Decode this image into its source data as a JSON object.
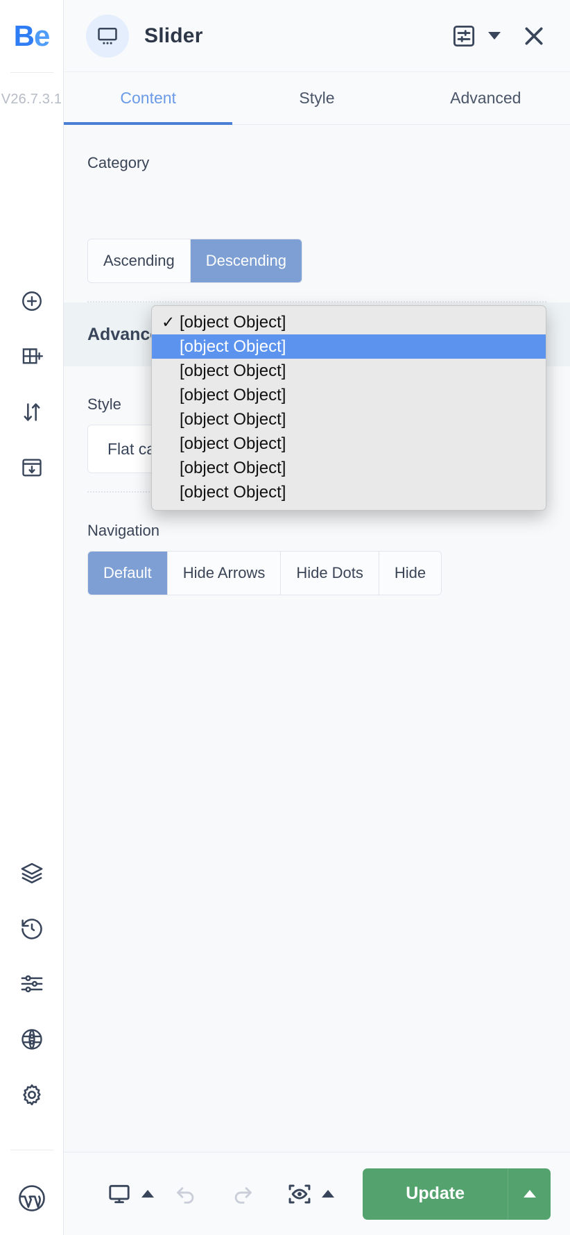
{
  "rail": {
    "logo_first": "Be",
    "logo_b": "B",
    "logo_e": "e",
    "version": "V26.7.3.1",
    "top_icons": [
      {
        "name": "add-element-icon",
        "label": "Add element"
      },
      {
        "name": "add-section-icon",
        "label": "Add section"
      },
      {
        "name": "sort-icon",
        "label": "Reorder"
      },
      {
        "name": "import-template-icon",
        "label": "Import template"
      }
    ],
    "bottom_icons": [
      {
        "name": "layers-icon",
        "label": "Layers"
      },
      {
        "name": "history-icon",
        "label": "History"
      },
      {
        "name": "settings-sliders-icon",
        "label": "Options"
      },
      {
        "name": "globe-icon",
        "label": "Global"
      },
      {
        "name": "gear-icon",
        "label": "Settings"
      },
      {
        "name": "wordpress-icon",
        "label": "WordPress"
      }
    ]
  },
  "header": {
    "widget_icon": "monitor-slider-icon",
    "title": "Slider",
    "settings_icon": "widget-settings-icon",
    "dropdown_icon": "chevron-down-icon",
    "close_icon": "close-icon"
  },
  "tabs": [
    {
      "label": "Content",
      "active": true
    },
    {
      "label": "Style",
      "active": false
    },
    {
      "label": "Advanced",
      "active": false
    }
  ],
  "content": {
    "category_label": "Category",
    "category_options": [
      {
        "text": "[object Object]",
        "checked": true,
        "highlight": false
      },
      {
        "text": "[object Object]",
        "checked": false,
        "highlight": true
      },
      {
        "text": "[object Object]",
        "checked": false,
        "highlight": false
      },
      {
        "text": "[object Object]",
        "checked": false,
        "highlight": false
      },
      {
        "text": "[object Object]",
        "checked": false,
        "highlight": false
      },
      {
        "text": "[object Object]",
        "checked": false,
        "highlight": false
      },
      {
        "text": "[object Object]",
        "checked": false,
        "highlight": false
      },
      {
        "text": "[object Object]",
        "checked": false,
        "highlight": false
      }
    ],
    "order_options": [
      {
        "label": "Ascending",
        "active": false
      },
      {
        "label": "Descending",
        "active": true
      }
    ]
  },
  "advanced": {
    "section_title": "Advanced",
    "style_label": "Style",
    "style_value": "Flat carousel with titles",
    "navigation_label": "Navigation",
    "navigation_options": [
      {
        "label": "Default",
        "active": true
      },
      {
        "label": "Hide Arrows",
        "active": false
      },
      {
        "label": "Hide Dots",
        "active": false
      },
      {
        "label": "Hide",
        "active": false
      }
    ]
  },
  "footer": {
    "responsive_icon": "monitor-icon",
    "undo_icon": "undo-icon",
    "redo_icon": "redo-icon",
    "preview_icon": "preview-eye-icon",
    "update_label": "Update",
    "update_caret_icon": "caret-up-icon"
  },
  "colors": {
    "brand_blue": "#2f7df4",
    "tab_active": "#6b9ae8",
    "segment_active": "#7d9fd4",
    "popup_highlight": "#5b93ef",
    "update_green": "#54a36f",
    "panel_bg": "#f7f9fb",
    "section_bg": "#edf2f4"
  }
}
